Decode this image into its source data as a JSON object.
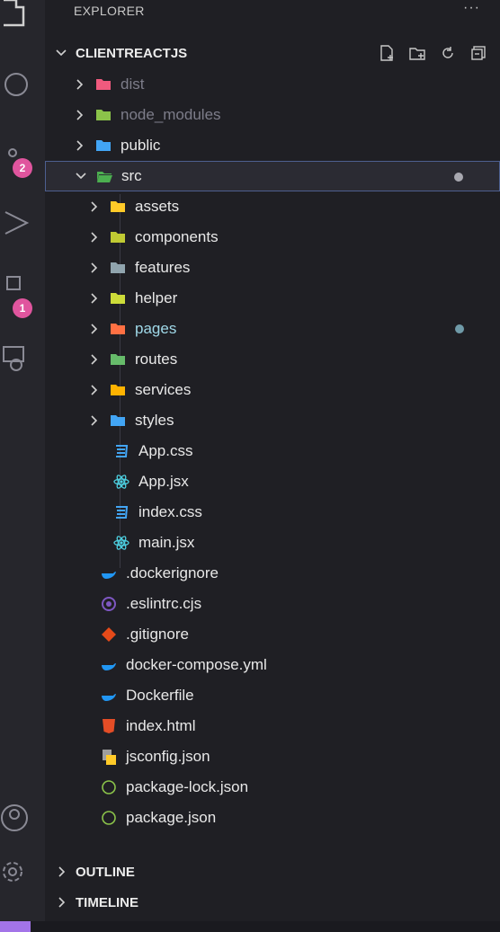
{
  "activity_bar": {
    "scm_badge": "2",
    "extensions_badge": "1",
    "icons": [
      "files-icon",
      "search-icon",
      "source-control-icon",
      "run-debug-icon",
      "extensions-icon",
      "remote-explorer-icon",
      "account-icon",
      "settings-gear-icon"
    ]
  },
  "explorer": {
    "title": "EXPLORER",
    "more": "···"
  },
  "project": {
    "name": "CLIENTREACTJS",
    "actions": [
      "new-file-icon",
      "new-folder-icon",
      "refresh-icon",
      "collapse-all-icon"
    ]
  },
  "tree": [
    {
      "label": "dist",
      "type": "folder",
      "icon": "folder-dist-icon",
      "color": "#f05a7e",
      "style": "dim"
    },
    {
      "label": "node_modules",
      "type": "folder",
      "icon": "folder-node-icon",
      "color": "#8bc34a",
      "style": "dim"
    },
    {
      "label": "public",
      "type": "folder",
      "icon": "folder-public-icon",
      "color": "#42a5f5",
      "style": "normal"
    },
    {
      "label": "src",
      "type": "folder-open",
      "icon": "folder-src-icon",
      "color": "#4caf50",
      "style": "normal"
    },
    {
      "label": "assets",
      "type": "folder",
      "icon": "folder-assets-icon",
      "color": "#ffca28",
      "style": "normal"
    },
    {
      "label": "components",
      "type": "folder",
      "icon": "folder-components-icon",
      "color": "#c0ca33",
      "style": "normal"
    },
    {
      "label": "features",
      "type": "folder",
      "icon": "folder-icon",
      "color": "#90a4ae",
      "style": "normal"
    },
    {
      "label": "helper",
      "type": "folder",
      "icon": "folder-helper-icon",
      "color": "#cddc39",
      "style": "normal"
    },
    {
      "label": "pages",
      "type": "folder",
      "icon": "folder-pages-icon",
      "color": "#ff7043",
      "style": "teal"
    },
    {
      "label": "routes",
      "type": "folder",
      "icon": "folder-routes-icon",
      "color": "#66bb6a",
      "style": "normal"
    },
    {
      "label": "services",
      "type": "folder",
      "icon": "folder-services-icon",
      "color": "#ffb300",
      "style": "normal"
    },
    {
      "label": "styles",
      "type": "folder",
      "icon": "folder-styles-icon",
      "color": "#42a5f5",
      "style": "normal"
    },
    {
      "label": "App.css",
      "type": "file",
      "icon": "css-file-icon",
      "color": "#42a5f5",
      "style": "normal"
    },
    {
      "label": "App.jsx",
      "type": "file",
      "icon": "react-file-icon",
      "color": "#4dd0e1",
      "style": "normal"
    },
    {
      "label": "index.css",
      "type": "file",
      "icon": "css-file-icon",
      "color": "#42a5f5",
      "style": "normal"
    },
    {
      "label": "main.jsx",
      "type": "file",
      "icon": "react-file-icon",
      "color": "#4dd0e1",
      "style": "normal"
    },
    {
      "label": ".dockerignore",
      "type": "file",
      "icon": "docker-file-icon",
      "color": "#2196f3",
      "style": "normal"
    },
    {
      "label": ".eslintrc.cjs",
      "type": "file",
      "icon": "eslint-file-icon",
      "color": "#7e57c2",
      "style": "normal"
    },
    {
      "label": ".gitignore",
      "type": "file",
      "icon": "git-file-icon",
      "color": "#e64a19",
      "style": "normal"
    },
    {
      "label": "docker-compose.yml",
      "type": "file",
      "icon": "docker-file-icon",
      "color": "#2196f3",
      "style": "normal"
    },
    {
      "label": "Dockerfile",
      "type": "file",
      "icon": "docker-file-icon",
      "color": "#2196f3",
      "style": "normal"
    },
    {
      "label": "index.html",
      "type": "file",
      "icon": "html-file-icon",
      "color": "#e44d26",
      "style": "normal"
    },
    {
      "label": "jsconfig.json",
      "type": "file",
      "icon": "jsconfig-file-icon",
      "color": "#ffca28",
      "style": "normal"
    },
    {
      "label": "package-lock.json",
      "type": "file",
      "icon": "npm-file-icon",
      "color": "#8bc34a",
      "style": "normal"
    },
    {
      "label": "package.json",
      "type": "file",
      "icon": "npm-file-icon",
      "color": "#8bc34a",
      "style": "normal"
    }
  ],
  "sections": {
    "outline": "OUTLINE",
    "timeline": "TIMELINE"
  },
  "colors": {
    "background": "#1f1f24",
    "selection_border": "#4d5f8f",
    "badge": "#e0559e",
    "status_accent": "#a374e8"
  }
}
